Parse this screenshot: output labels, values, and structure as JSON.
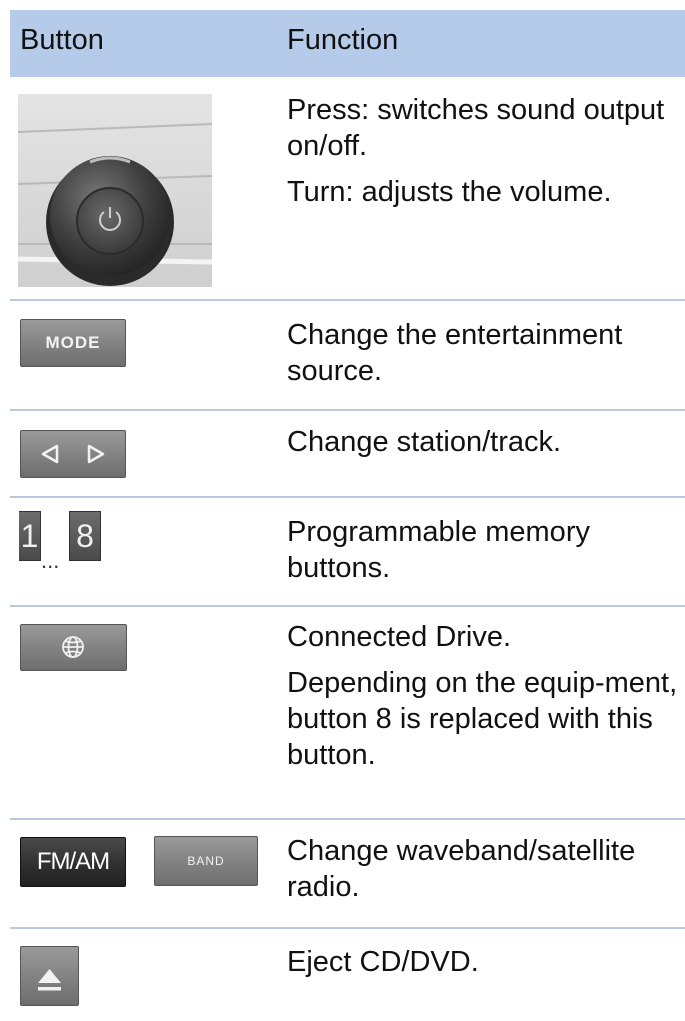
{
  "header": {
    "col_button": "Button",
    "col_function": "Function"
  },
  "rows": [
    {
      "icon": "volume-knob",
      "lines": [
        "Press: switches sound output on/off.",
        "Turn: adjusts the volume."
      ]
    },
    {
      "icon": "mode-button",
      "label": "MODE",
      "lines": [
        "Change the entertainment source."
      ]
    },
    {
      "icon": "arrow-buttons",
      "lines": [
        "Change station/track."
      ]
    },
    {
      "icon": "memory-buttons",
      "labels": [
        "1",
        "...",
        "8"
      ],
      "lines": [
        "Programmable memory buttons."
      ]
    },
    {
      "icon": "globe-button",
      "lines": [
        "Connected Drive.",
        "Depending on the equip-ment, button 8 is replaced with this button."
      ]
    },
    {
      "icon": "waveband-buttons",
      "labels": [
        "FM/AM",
        "BAND"
      ],
      "lines": [
        "Change waveband/satellite radio."
      ]
    },
    {
      "icon": "eject-button",
      "lines": [
        "Eject CD/DVD."
      ]
    }
  ]
}
